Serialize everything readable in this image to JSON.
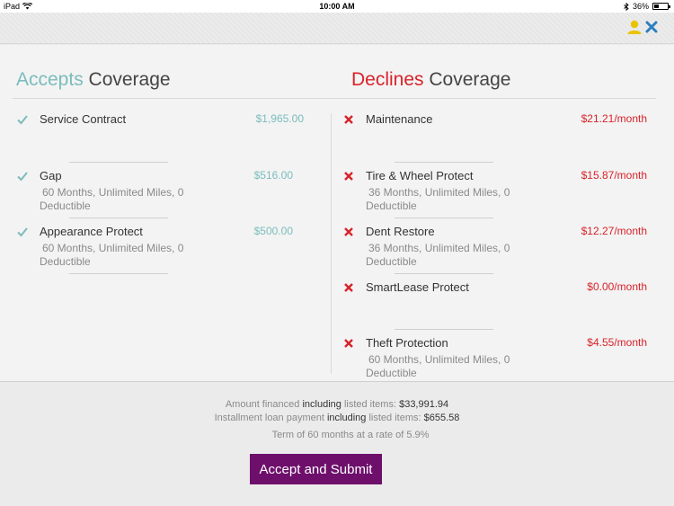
{
  "status_bar": {
    "device": "iPad",
    "time": "10:00 AM",
    "battery": "36%",
    "battery_level": 0.36
  },
  "header": {
    "user_icon": "user-icon",
    "close_icon": "close-icon",
    "colors": {
      "user": "#e8c400",
      "close": "#2a7fc0"
    }
  },
  "accepts": {
    "word": "Accepts",
    "rest": " Coverage",
    "items": [
      {
        "name": "Service Contract",
        "price": "$1,965.00",
        "sub": ""
      },
      {
        "name": "Gap",
        "price": "$516.00",
        "sub": "60 Months, Unlimited Miles, 0 Deductible"
      },
      {
        "name": "Appearance Protect",
        "price": "$500.00",
        "sub": "60 Months, Unlimited Miles, 0 Deductible"
      }
    ]
  },
  "declines": {
    "word": "Declines",
    "rest": " Coverage",
    "items": [
      {
        "name": "Maintenance",
        "price": "$21.21/month",
        "sub": ""
      },
      {
        "name": "Tire & Wheel Protect",
        "price": "$15.87/month",
        "sub": "36 Months, Unlimited Miles, 0 Deductible"
      },
      {
        "name": "Dent Restore",
        "price": "$12.27/month",
        "sub": "36 Months, Unlimited Miles, 0 Deductible"
      },
      {
        "name": "SmartLease Protect",
        "price": "$0.00/month",
        "sub": ""
      },
      {
        "name": "Theft Protection",
        "price": "$4.55/month",
        "sub": "60 Months, Unlimited Miles, 0 Deductible"
      }
    ]
  },
  "summary": {
    "financed_prefix": "Amount financed ",
    "financed_strong": "including",
    "financed_mid": " listed items: ",
    "financed_value": "$33,991.94",
    "payment_prefix": "Installment loan payment ",
    "payment_strong": "including",
    "payment_mid": " listed items: ",
    "payment_value": "$655.58",
    "term": "Term of 60 months at a rate of 5.9%"
  },
  "submit_label": "Accept and Submit",
  "colors": {
    "accept": "#7bbcbc",
    "decline": "#d8232a",
    "button": "#6d0f6b"
  }
}
